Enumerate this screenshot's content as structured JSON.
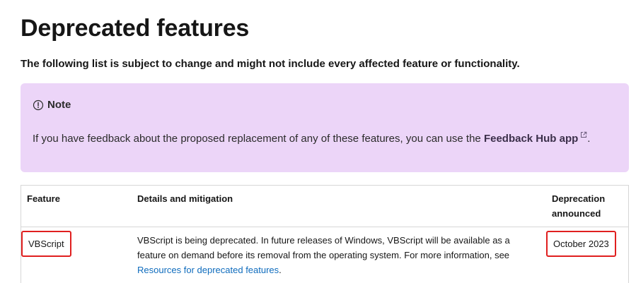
{
  "page": {
    "title": "Deprecated features",
    "intro": "The following list is subject to change and might not include every affected feature or functionality."
  },
  "note": {
    "label": "Note",
    "icon": "info-circle-icon",
    "text_before": "If you have feedback about the proposed replacement of any of these features, you can use the ",
    "link": "Feedback Hub app",
    "link_icon": "external-link-icon",
    "text_after": ".",
    "background": "#ecd5f8"
  },
  "table": {
    "headers": {
      "feature": "Feature",
      "details": "Details and mitigation",
      "deprecation": "Deprecation announced"
    },
    "rows": [
      {
        "feature": "VBScript",
        "details": "VBScript is being deprecated. In future releases of Windows, VBScript will be available as a feature on demand before its removal from the operating system. For more information, see ",
        "details_link": "Resources for deprecated features",
        "details_after": ".",
        "date": "October 2023"
      }
    ]
  },
  "colors": {
    "highlight": "#e01f1f",
    "link": "#0f6cbd"
  }
}
